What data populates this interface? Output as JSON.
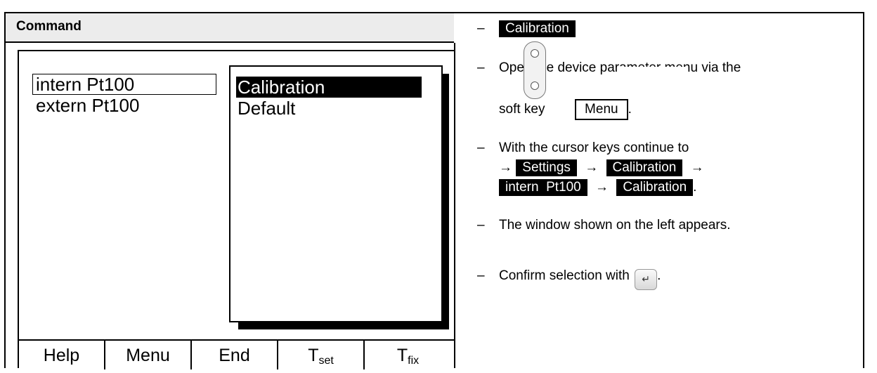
{
  "header": {
    "command_label": "Command"
  },
  "display": {
    "list": [
      "intern  Pt100",
      "extern  Pt100"
    ],
    "popup_options": [
      "Calibration",
      "Default"
    ],
    "softkeys": [
      {
        "main": "Help",
        "sub": ""
      },
      {
        "main": "Menu",
        "sub": ""
      },
      {
        "main": "End",
        "sub": ""
      },
      {
        "main": "T",
        "sub": "set"
      },
      {
        "main": "T",
        "sub": "fix"
      }
    ]
  },
  "instructions": {
    "dash": "–",
    "title": "Calibration",
    "step1_line1": "Open the device parameter menu via the",
    "step1_prefix": "soft key",
    "step1_key": "Menu",
    "step1_suffix": ".",
    "step2_line1": "With the cursor keys continue to",
    "arrow": "→",
    "path1": "Settings",
    "path2": "Calibration",
    "path3": "intern  Pt100",
    "path4": "Calibration",
    "path_end": ".",
    "step3": "The window shown on the left appears.",
    "step4_prefix": "Confirm selection with",
    "step4_suffix": ".",
    "enter_icon": "enter-key-icon"
  }
}
